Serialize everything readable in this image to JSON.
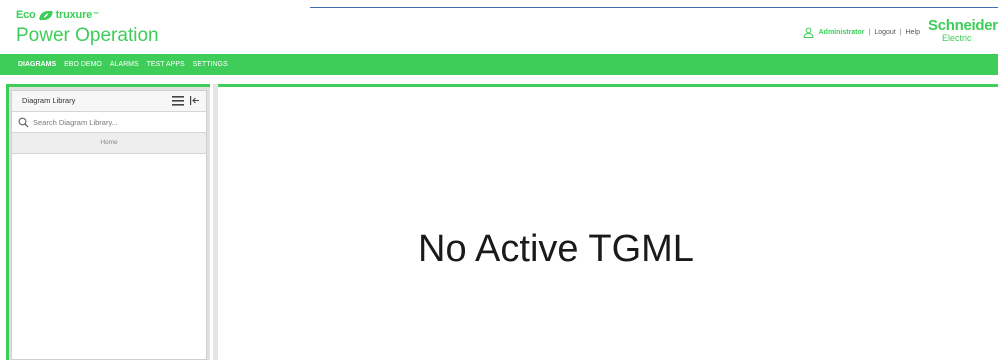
{
  "brand": {
    "logo_left": "Eco",
    "logo_right": "truxure",
    "logo_trademark": "™",
    "product_name": "Power Operation"
  },
  "header": {
    "user_name": "Administrator",
    "separator": "|",
    "logout_label": "Logout",
    "help_label": "Help",
    "vendor_name": "Schneider",
    "vendor_sub": "Electric"
  },
  "nav": {
    "items": [
      {
        "label": "DIAGRAMS",
        "active": true
      },
      {
        "label": "EBO DEMO",
        "active": false
      },
      {
        "label": "ALARMS",
        "active": false
      },
      {
        "label": "TEST APPS",
        "active": false
      },
      {
        "label": "SETTINGS",
        "active": false
      }
    ]
  },
  "library": {
    "title": "Diagram Library",
    "search_placeholder": "Search Diagram Library...",
    "breadcrumb": "Home",
    "icons": [
      "menu-icon",
      "collapse-left-icon",
      "search-icon"
    ]
  },
  "main": {
    "empty_message": "No Active TGML"
  },
  "colors": {
    "accent": "#3dcd58",
    "header_line": "#3d6fb3",
    "panel_bg": "#e0e0e0"
  }
}
